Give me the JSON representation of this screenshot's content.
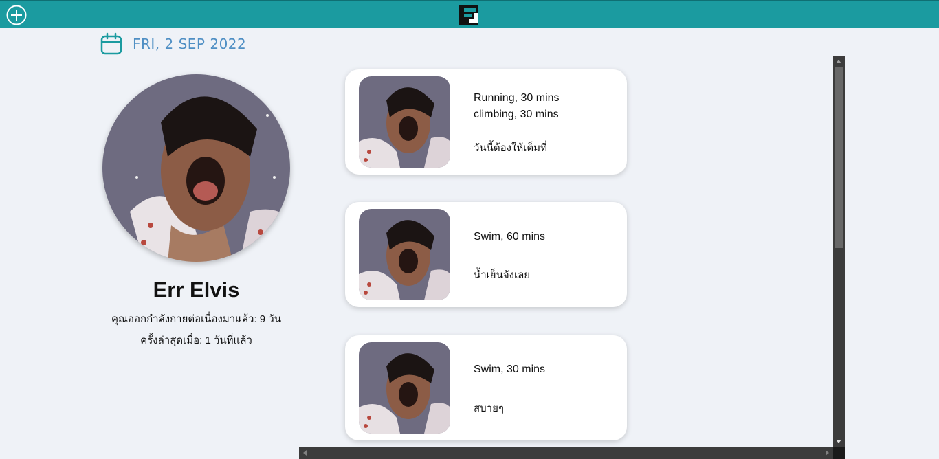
{
  "header": {
    "add_button_icon": "plus-circle-icon",
    "logo_icon": "brand-logo-icon",
    "accent_color": "#1b9ba0"
  },
  "date": {
    "icon": "calendar-icon",
    "text": "FRI, 2 SEP 2022"
  },
  "profile": {
    "name": "Err Elvis",
    "streak_text": "คุณออกกำลังกายต่อเนื่องมาแล้ว: 9 วัน",
    "last_text": "ครั้งล่าสุดเมื่อ: 1 วันที่แล้ว"
  },
  "posts": [
    {
      "activities": [
        "Running, 30 mins",
        "climbing, 30 mins"
      ],
      "note": "วันนี้ต้องให้เต็มที่"
    },
    {
      "activities": [
        "Swim, 60 mins"
      ],
      "note": "น้ำเย็นจังเลย"
    },
    {
      "activities": [
        "Swim, 30 mins"
      ],
      "note": "สบายๆ"
    }
  ]
}
